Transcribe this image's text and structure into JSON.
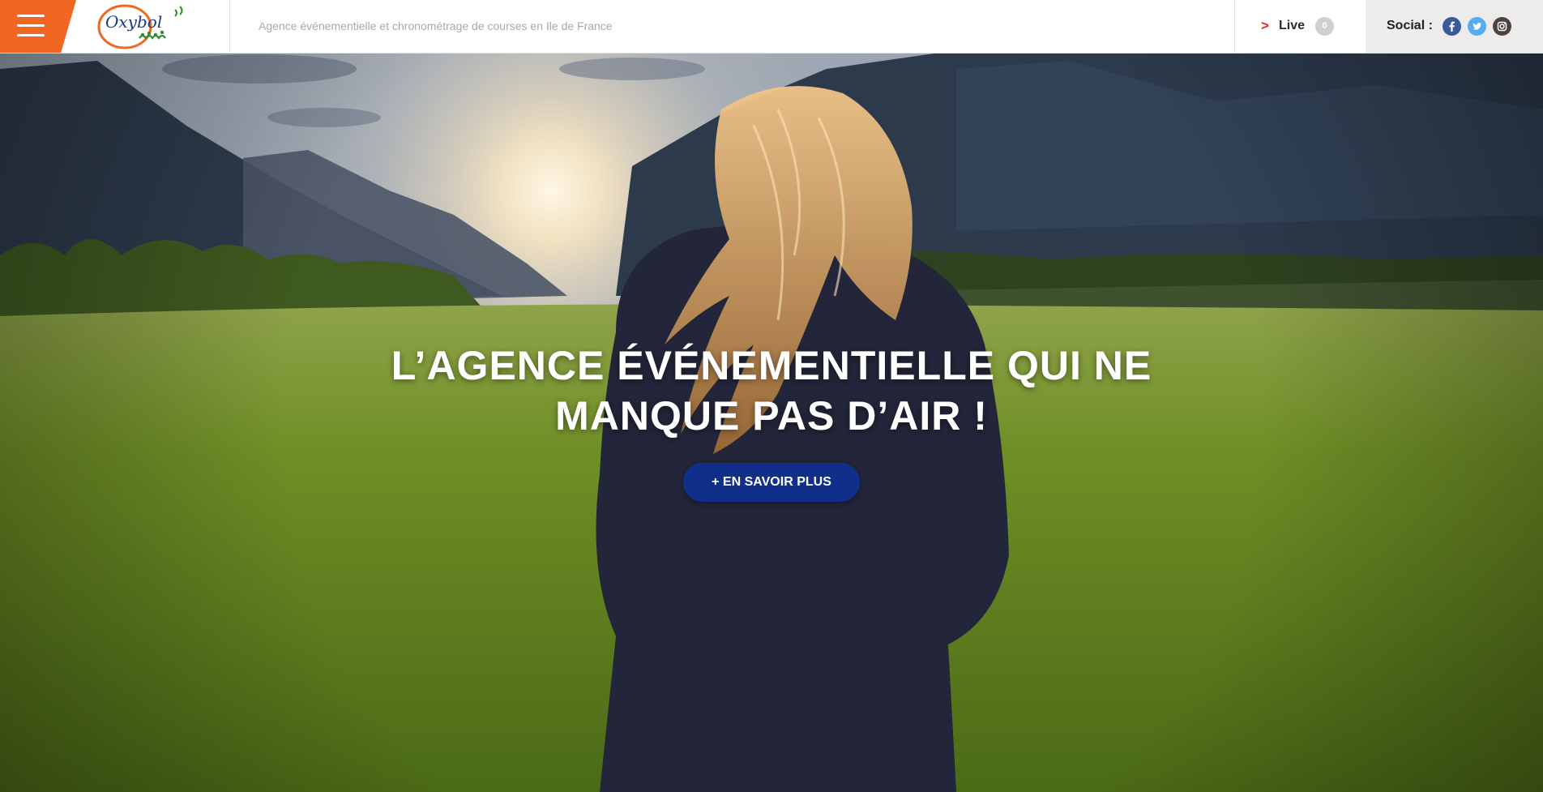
{
  "header": {
    "logo_text": "Oxybol",
    "tagline": "Agence événementielle et chronométrage de courses en Ile de France",
    "live": {
      "chevron": ">",
      "label": "Live",
      "count": "0"
    },
    "social": {
      "label": "Social :",
      "icons": [
        "facebook-icon",
        "twitter-icon",
        "instagram-icon"
      ]
    }
  },
  "hero": {
    "title_line1": "L’AGENCE ÉVÉNEMENTIELLE QUI NE",
    "title_line2": "MANQUE PAS D’AIR !",
    "cta_label": "+ EN SAVOIR PLUS"
  },
  "colors": {
    "accent_orange": "#f26522",
    "cta_blue": "#0f2f8a",
    "live_red": "#e5261f",
    "facebook": "#3b5998",
    "twitter": "#55acee",
    "instagram": "#4e433c"
  }
}
